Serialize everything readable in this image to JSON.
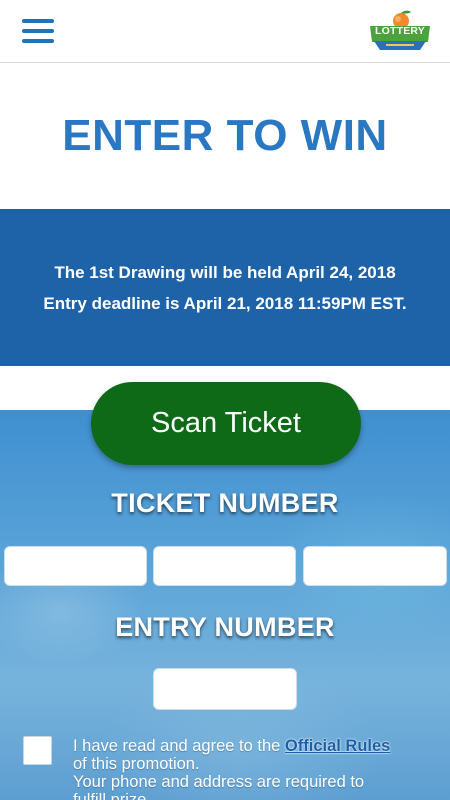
{
  "header": {
    "menu_icon": "hamburger-menu-icon",
    "logo_icon": "lottery-logo-icon",
    "logo_text": "LOTTERY",
    "brand_color": "#1f73b7"
  },
  "title": "ENTER TO WIN",
  "info": {
    "line1": "The 1st Drawing will be held April 24, 2018",
    "line2": "Entry deadline is April 21, 2018 11:59PM EST.",
    "background_color": "#1e63a7"
  },
  "scan_button": {
    "label": "Scan Ticket",
    "color": "#0f6a18"
  },
  "ticket_section": {
    "label": "TICKET NUMBER",
    "fields": [
      {
        "value": ""
      },
      {
        "value": ""
      },
      {
        "value": ""
      }
    ]
  },
  "entry_section": {
    "label": "ENTRY NUMBER",
    "value": ""
  },
  "agreement": {
    "checked": false,
    "text_before": "I have read and agree to the ",
    "rules_link": "Official Rules",
    "text_after": " of this promotion.",
    "line2": "Your phone and address are required to",
    "line3": "fulfill prize."
  }
}
